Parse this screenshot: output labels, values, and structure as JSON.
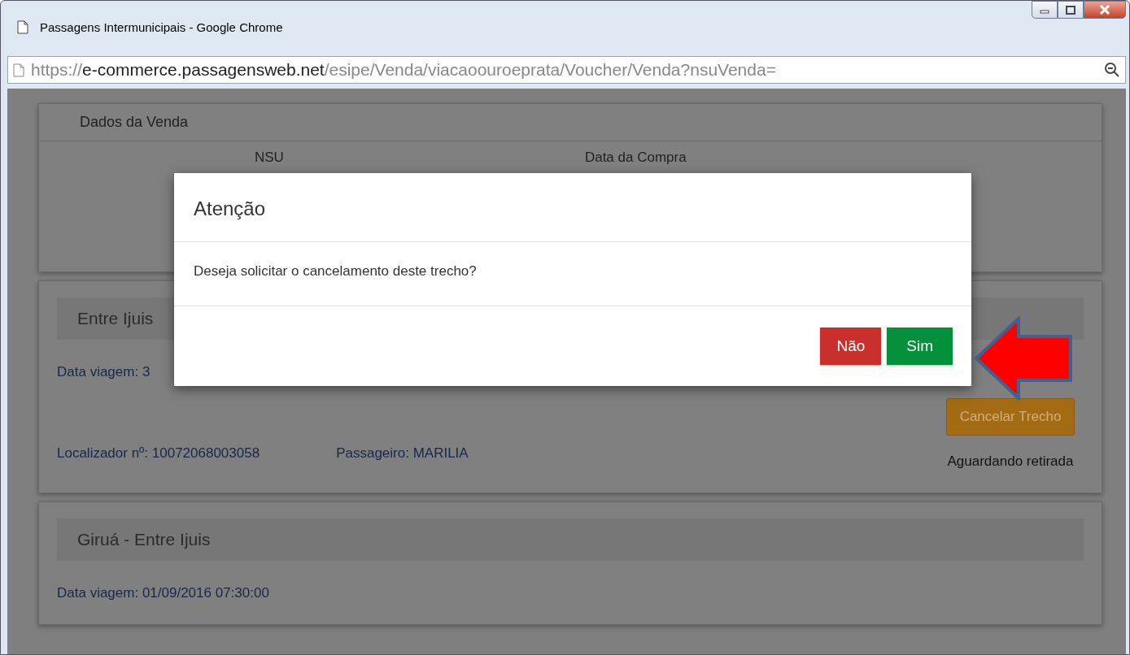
{
  "window": {
    "title": "Passagens Intermunicipais - Google Chrome"
  },
  "address_bar": {
    "url_scheme": "https://",
    "url_host": "e-commerce.passagensweb.net",
    "url_path": "/esipe/Venda/viacaoouroeprata/Voucher/Venda?nsuVenda="
  },
  "sale_panel": {
    "title": "Dados da Venda",
    "columns": [
      "NSU",
      "Data da Compra"
    ]
  },
  "trips": [
    {
      "title": "Entre Ijuis",
      "date": "Data viagem: 3",
      "locator": "Localizador nº: 10072068003058",
      "passenger": "Passageiro: MARILIA",
      "button": "Cancelar Trecho",
      "status": "Aguardando retirada"
    },
    {
      "title": "Giruá - Entre Ijuis",
      "date": "Data viagem: 01/09/2016 07:30:00"
    }
  ],
  "dialog": {
    "title": "Atenção",
    "message": "Deseja solicitar o cancelamento deste trecho?",
    "buttons": [
      {
        "label": "Não",
        "kind": "danger"
      },
      {
        "label": "Sim",
        "kind": "success"
      }
    ]
  }
}
